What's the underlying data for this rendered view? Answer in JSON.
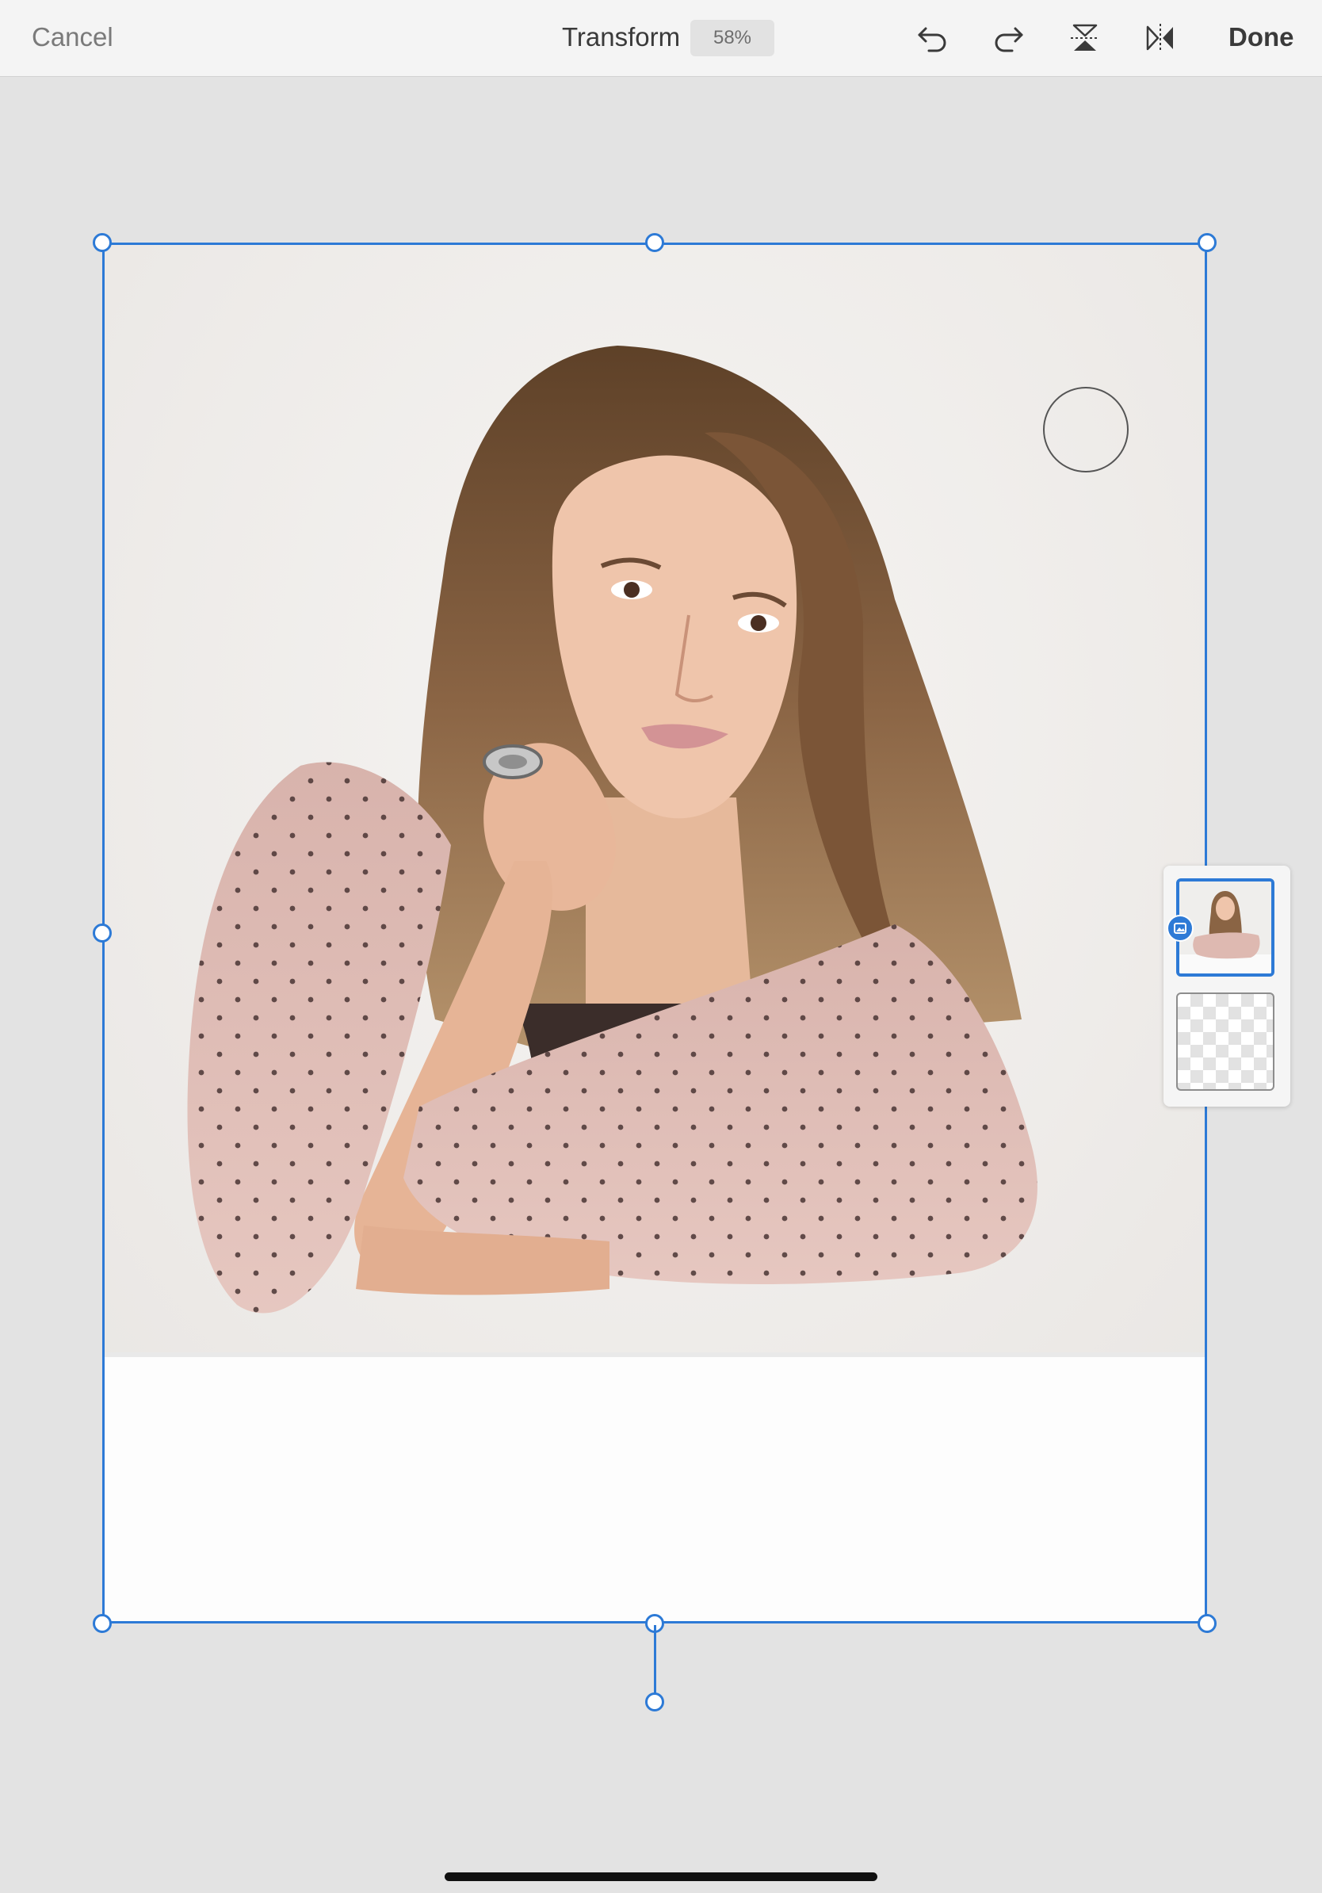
{
  "toolbar": {
    "cancel_label": "Cancel",
    "title": "Transform",
    "zoom_level": "58%",
    "done_label": "Done",
    "icons": [
      "undo-icon",
      "redo-icon",
      "flip-vertical-icon",
      "flip-horizontal-icon"
    ]
  },
  "canvas": {
    "image_subject": "portrait photo",
    "selection_color": "#2d7ad6",
    "background_color": "#e3e3e3"
  },
  "layers": {
    "items": [
      {
        "type": "image",
        "selected": true
      },
      {
        "type": "empty",
        "selected": false
      }
    ]
  }
}
